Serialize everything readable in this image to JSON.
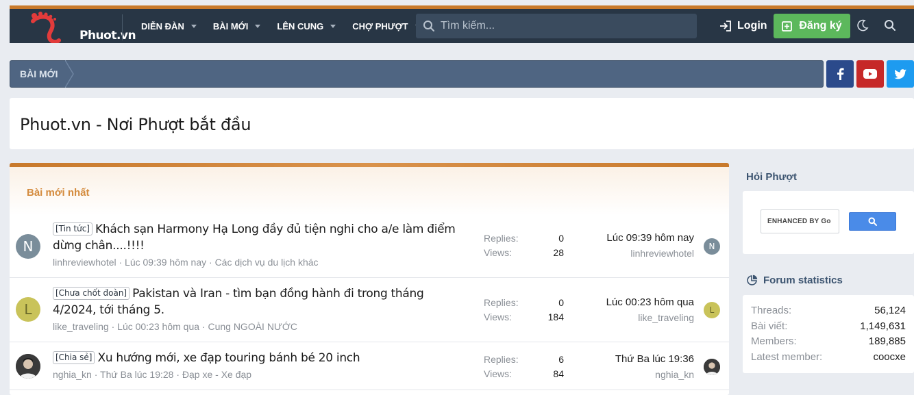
{
  "header": {
    "logo_text": "Phuot.vn",
    "nav": [
      "DIỄN ĐÀN",
      "BÀI MỚI",
      "LÊN CUNG",
      "CHỢ PHƯỢT"
    ],
    "search_placeholder": "Tìm kiếm...",
    "login_label": "Login",
    "register_label": "Đăng ký",
    "accent": "#c8792b",
    "register_color": "#5cb85c"
  },
  "breadcrumb": {
    "item": "BÀI MỚI"
  },
  "social": [
    "facebook-icon",
    "youtube-icon",
    "twitter-icon"
  ],
  "page": {
    "title": "Phuot.vn - Nơi Phượt bắt đầu"
  },
  "main": {
    "heading": "Bài mới nhất",
    "threads": [
      {
        "avatar": "N",
        "prefix": "[Tin tức]",
        "title": "Khách sạn Harmony Hạ Long đầy đủ tiện nghi cho a/e làm điểm dừng chân....!!!!",
        "meta": "linhreviewhotel · Lúc 09:39 hôm nay · Các dịch vụ du lịch khác",
        "replies_label": "Replies:",
        "replies": "0",
        "views_label": "Views:",
        "views": "28",
        "last_time": "Lúc 09:39 hôm nay",
        "last_user": "linhreviewhotel",
        "last_avatar": "N"
      },
      {
        "avatar": "L",
        "prefix": "[Chưa chốt đoàn]",
        "title": "Pakistan và Iran - tìm bạn đồng hành đi trong tháng 4/2024, tới tháng 5.",
        "meta": "like_traveling · Lúc 00:23 hôm qua · Cung NGOÀI NƯỚC",
        "replies_label": "Replies:",
        "replies": "0",
        "views_label": "Views:",
        "views": "184",
        "last_time": "Lúc 00:23 hôm qua",
        "last_user": "like_traveling",
        "last_avatar": "L"
      },
      {
        "avatar": "",
        "prefix": "[Chia sẻ]",
        "title": "Xu hướng mới, xe đạp touring bánh bé 20 inch",
        "meta": "nghia_kn · Thứ Ba lúc 19:28 · Đạp xe - Xe đạp",
        "replies_label": "Replies:",
        "replies": "6",
        "views_label": "Views:",
        "views": "84",
        "last_time": "Thứ Ba lúc 19:36",
        "last_user": "nghia_kn",
        "last_avatar": ""
      }
    ]
  },
  "sidebar": {
    "ask_title": "Hỏi Phượt",
    "google_label": "ENHANCED BY Go",
    "stats_title": "Forum statistics",
    "stats": [
      {
        "label": "Threads:",
        "value": "56,124"
      },
      {
        "label": "Bài viết:",
        "value": "1,149,631"
      },
      {
        "label": "Members:",
        "value": "189,885"
      },
      {
        "label": "Latest member:",
        "value": "coocxe"
      }
    ]
  }
}
